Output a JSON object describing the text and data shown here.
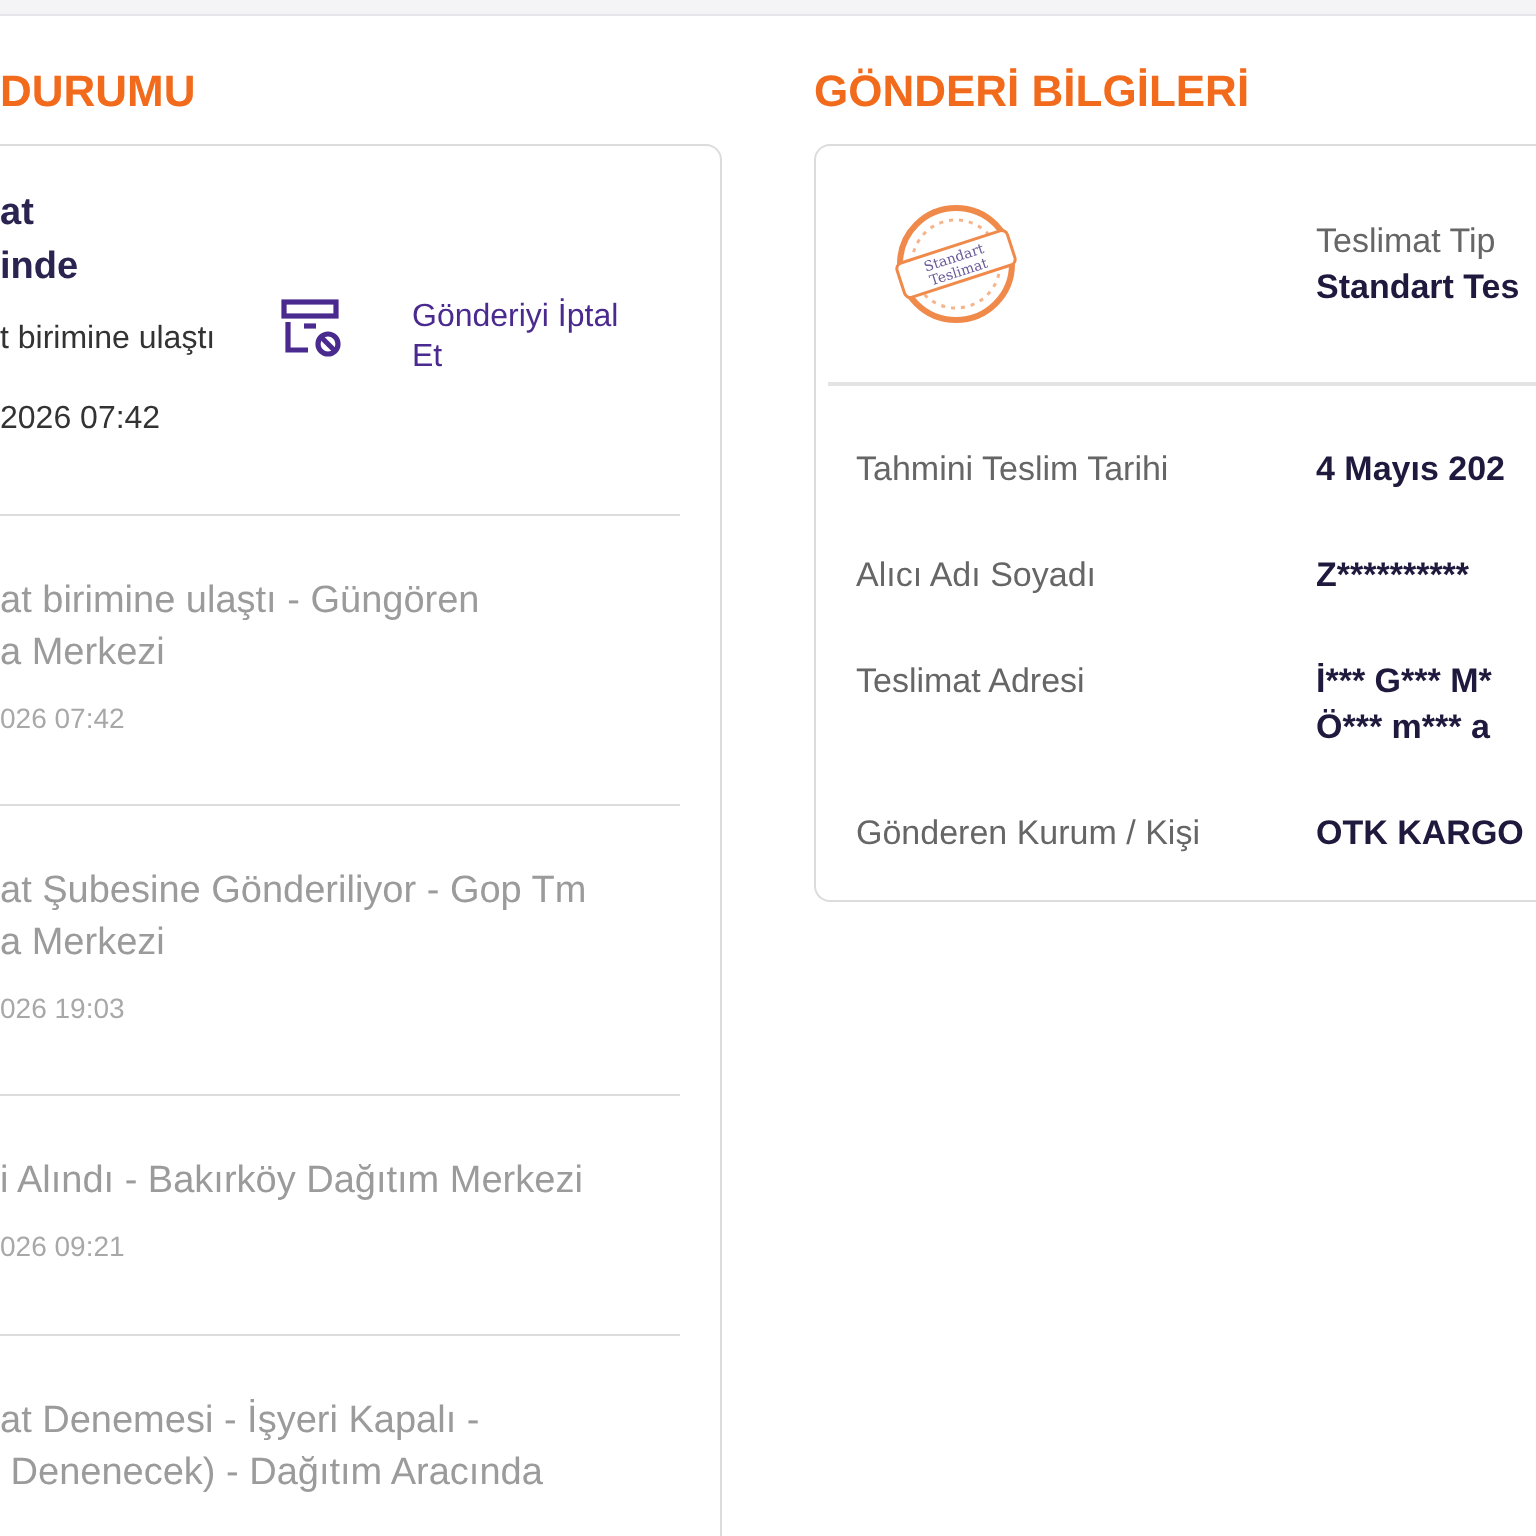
{
  "status_section": {
    "title": "DURUMU",
    "current": {
      "title_lines": [
        "at",
        "inde"
      ],
      "status": "t birimine ulaştı",
      "date": "2026 07:42",
      "cancel_link": "Gönderiyi İptal Et"
    },
    "history": [
      {
        "title": "at birimine ulaştı - Güngören\na Merkezi",
        "date": "026 07:42"
      },
      {
        "title": "at Şubesine Gönderiliyor - Gop Tm\na Merkezi",
        "date": "026 19:03"
      },
      {
        "title": "i Alındı - Bakırköy Dağıtım Merkezi",
        "date": "026 09:21"
      },
      {
        "title": "at Denemesi - İşyeri Kapalı -\n Denenecek) - Dağıtım Aracında"
      }
    ]
  },
  "shipment_section": {
    "title": "GÖNDERİ BİLGİLERİ",
    "stamp_text": "Standart Teslimat",
    "delivery_type": {
      "label": "Teslimat Tip",
      "value": "Standart Tes"
    },
    "rows": [
      {
        "label": "Tahmini Teslim Tarihi",
        "value": "4 Mayıs 202"
      },
      {
        "label": "Alıcı Adı Soyadı",
        "value": "Z**********"
      },
      {
        "label": "Teslimat Adresi",
        "value": "İ*** G*** M*\nÖ*** m*** a"
      },
      {
        "label": "Gönderen Kurum / Kişi",
        "value": "OTK KARGO"
      }
    ]
  }
}
